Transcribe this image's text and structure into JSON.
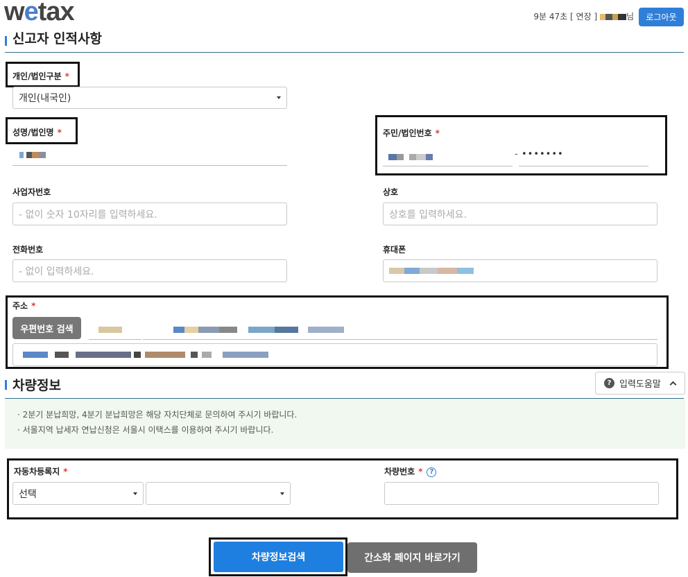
{
  "header": {
    "logo_prefix": "w",
    "logo_e": "e",
    "logo_suffix": "tax",
    "session_time": "9분 47초",
    "extend_label": "[ 연장 ]",
    "user_suffix": "님",
    "logout_label": "로그아웃"
  },
  "reporter": {
    "section_title": "신고자 인적사항",
    "type_label": "개인/법인구분",
    "type_value": "개인(내국인)",
    "name_label": "성명/법인명",
    "id_label": "주민/법인번호",
    "id_back": "•••••••",
    "id_dash": "-",
    "biz_label": "사업자번호",
    "biz_placeholder": "- 없이 숫자 10자리를 입력하세요.",
    "company_label": "상호",
    "company_placeholder": "상호를 입력하세요.",
    "phone_label": "전화번호",
    "phone_placeholder": "- 없이 입력하세요.",
    "mobile_label": "휴대폰",
    "address_label": "주소",
    "zip_button": "우편번호 검색",
    "required_mark": "*"
  },
  "vehicle": {
    "section_title": "차량정보",
    "help_button": "입력도움말",
    "notices": [
      "· 2분기 분납희망, 4분기 분납희망은 해당 자치단체로 문의하여 주시기 바랍니다.",
      "· 서울지역 납세자 연납신청은 서울시 이택스를 이용하여 주시기 바랍니다."
    ],
    "region_label": "자동차등록지",
    "region_select1": "선택",
    "region_select2": "",
    "plate_label": "차량번호",
    "plate_value": ""
  },
  "actions": {
    "search_button": "차량정보검색",
    "simple_button": "간소화 페이지 바로가기"
  },
  "colors": {
    "accent": "#2f7fd8",
    "required": "#e03a3a",
    "notice_bg": "#f1f8ef"
  }
}
